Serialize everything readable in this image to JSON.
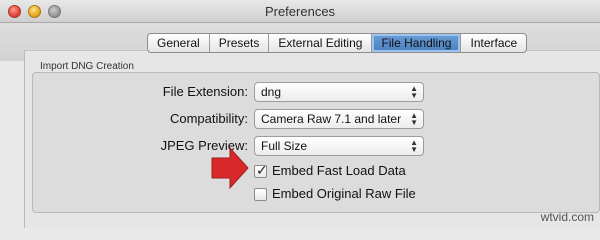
{
  "window": {
    "title": "Preferences"
  },
  "tabs": [
    {
      "label": "General"
    },
    {
      "label": "Presets"
    },
    {
      "label": "External Editing"
    },
    {
      "label": "File Handling"
    },
    {
      "label": "Interface"
    }
  ],
  "selected_tab": "File Handling",
  "group": {
    "title": "Import DNG Creation"
  },
  "fields": {
    "file_extension": {
      "label": "File Extension:",
      "value": "dng"
    },
    "compatibility": {
      "label": "Compatibility:",
      "value": "Camera Raw 7.1 and later"
    },
    "jpeg_preview": {
      "label": "JPEG Preview:",
      "value": "Full Size"
    }
  },
  "checkboxes": {
    "embed_fast_load": {
      "label": "Embed Fast Load Data",
      "checked": true
    },
    "embed_original_raw": {
      "label": "Embed Original Raw File",
      "checked": false
    }
  },
  "watermark": "wtvid.com",
  "colors": {
    "accent_selected_tab": "#4a7fc0",
    "arrow": "#d9282a"
  }
}
